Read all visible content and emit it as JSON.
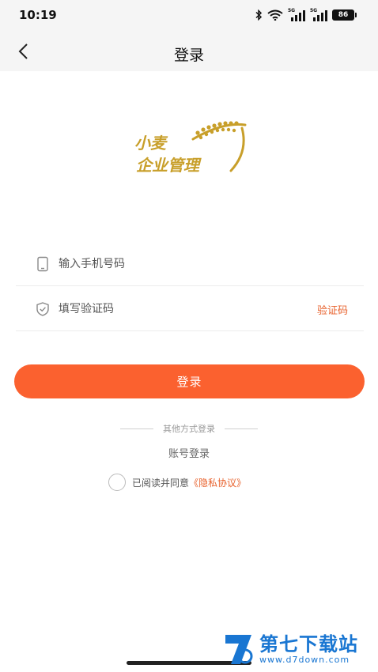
{
  "status": {
    "time": "10:19",
    "net1": "5G",
    "net2": "5G",
    "battery": "86"
  },
  "nav": {
    "title": "登录"
  },
  "logo": {
    "line1": "小麦",
    "line2": "企业管理"
  },
  "form": {
    "phone_placeholder": "输入手机号码",
    "code_placeholder": "填写验证码",
    "code_button": "验证码"
  },
  "login_button": "登录",
  "other": {
    "label": "其他方式登录",
    "account_login": "账号登录"
  },
  "agreement": {
    "text": "已阅读并同意",
    "policy": "《隐私协议》"
  },
  "watermark": {
    "title": "第七下载站",
    "url": "www.d7down.com"
  },
  "colors": {
    "accent": "#fb612f",
    "link": "#e8622d",
    "logo_gold": "#c89f2a",
    "watermark_blue": "#1976d2"
  }
}
